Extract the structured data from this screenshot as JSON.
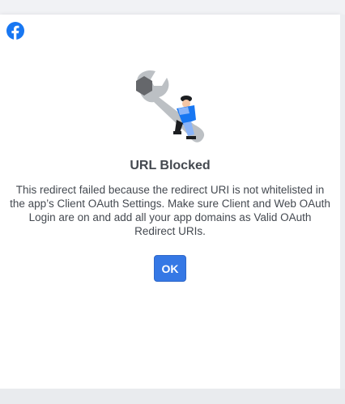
{
  "dialog": {
    "title": "URL Blocked",
    "message": "This redirect failed because the redirect URI is not whitelisted in the app’s Client OAuth Settings. Make sure Client and Web OAuth Login are on and add all your app domains as Valid OAuth Redirect URIs.",
    "ok_label": "OK"
  },
  "icons": {
    "logo": "facebook-logo-icon",
    "illustration": "wrench-worker-illustration"
  },
  "colors": {
    "brand_blue": "#1877f2",
    "button_blue": "#3578e5",
    "text": "#444950"
  }
}
